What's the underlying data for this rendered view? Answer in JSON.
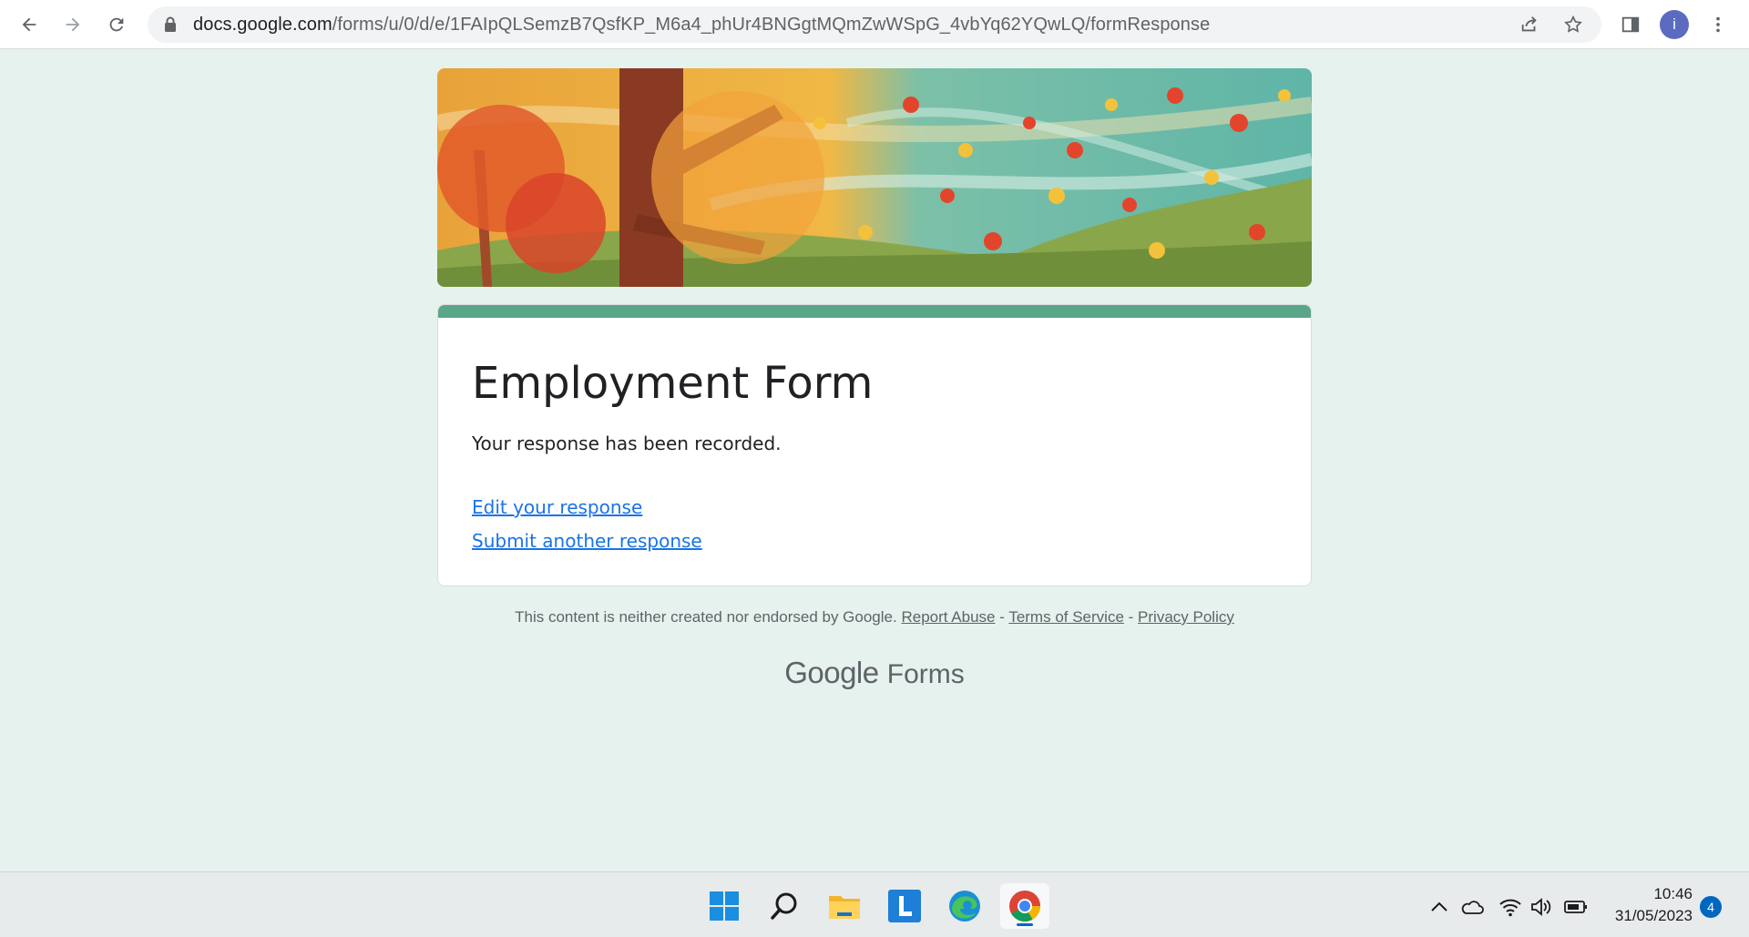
{
  "browser": {
    "url_host": "docs.google.com",
    "url_path": "/forms/u/0/d/e/1FAIpQLSemzB7QsfKP_M6a4_phUr4BNGgtMQmZwWSpG_4vbYq62YQwLQ/formResponse",
    "profile_initial": "i"
  },
  "form": {
    "title": "Employment Form",
    "message": "Your response has been recorded.",
    "edit_link": "Edit your response",
    "submit_another_link": "Submit another response"
  },
  "footer": {
    "disclaimer": "This content is neither created nor endorsed by Google.",
    "report_abuse": "Report Abuse",
    "separator": "-",
    "terms": "Terms of Service",
    "privacy": "Privacy Policy"
  },
  "brand": {
    "google": "Google",
    "product": "Forms"
  },
  "taskbar": {
    "apps": [
      "start-icon",
      "search-icon",
      "file-explorer-icon",
      "l-app-icon",
      "edge-icon",
      "chrome-icon"
    ],
    "time": "10:46",
    "date": "31/05/2023",
    "notification_count": "4"
  },
  "colors": {
    "page_bg": "#e6f2ee",
    "accent": "#5aa689",
    "link": "#1a73e8"
  }
}
